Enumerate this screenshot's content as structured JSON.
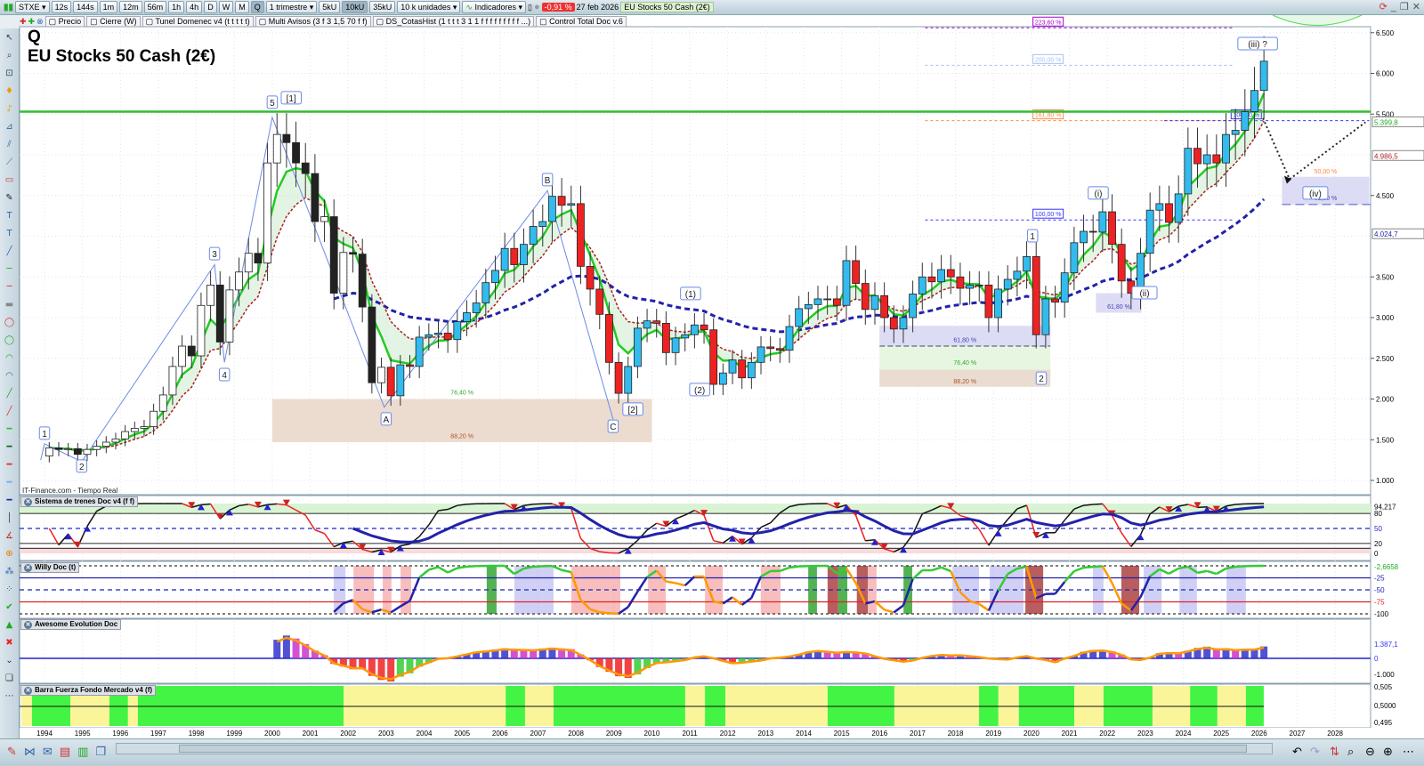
{
  "toolbar": {
    "symbol": "STXE",
    "timeframes": [
      "12s",
      "144s",
      "1m",
      "12m",
      "56m",
      "1h",
      "4h",
      "D",
      "W",
      "M",
      "Q"
    ],
    "active_timeframe": "Q",
    "period": "1 trimestre",
    "units": [
      "5kU",
      "10kU",
      "35kU"
    ],
    "active_unit": "10kU",
    "units_select": "10 k unidades",
    "indicators": "Indicadores",
    "change": "-0,91 %",
    "date": "27 feb 2026",
    "instrument": "EU Stocks 50 Cash (2€)"
  },
  "overlays": [
    "Precio",
    "Cierre (W)",
    "Tunel Domenec v4 (t t t t t)",
    "Multi Avisos (3 f 3 1,5 70 f f)",
    "DS_CotasHist (1 t t t 3 1 1 f f f f f f f f f ...)",
    "Control Total Doc v.6"
  ],
  "chart": {
    "period_letter": "Q",
    "title": "EU Stocks 50 Cash (2€)",
    "source": "IT-Finance.com - Tiempo Real"
  },
  "panels": {
    "trenes": "Sistema de trenes Doc v4 (f f)",
    "willy": "Willy Doc (t)",
    "awesome": "Awesome Evolution Doc",
    "barra": "Barra Fuerza Fondo Mercado v4 (f)"
  },
  "axis_labels": {
    "price": [
      "6.500",
      "6.000",
      "5.500",
      "4.500",
      "3.500",
      "3.000",
      "2.500",
      "2.000",
      "1.500",
      "1.000"
    ],
    "tags": {
      "green": "5.399,8",
      "red": "4.986,5",
      "blue": "4.024,7"
    },
    "trenes": [
      "94,217",
      "80",
      "50",
      "20",
      "0"
    ],
    "willy": [
      "-2,6658",
      "-25",
      "-50",
      "-75",
      "-100"
    ],
    "awesome": [
      "1.387,1",
      "0",
      "-1.000"
    ],
    "barra": [
      "0,505",
      "0,5000",
      "0,495"
    ]
  },
  "chart_data": {
    "type": "candlestick",
    "start_year": 1994,
    "period": "quarter",
    "closes": [
      1400,
      1380,
      1390,
      1320,
      1380,
      1420,
      1470,
      1510,
      1600,
      1640,
      1660,
      1850,
      2050,
      2400,
      2650,
      2530,
      3150,
      3400,
      2700,
      3340,
      3560,
      3790,
      3670,
      4900,
      5250,
      5150,
      4900,
      4770,
      4180,
      4240,
      3300,
      3800,
      3780,
      3130,
      2200,
      2390,
      2040,
      2420,
      2400,
      2760,
      2790,
      2810,
      2730,
      2950,
      3060,
      3180,
      3430,
      3580,
      3850,
      3650,
      3900,
      4120,
      4180,
      4490,
      4380,
      4400,
      3630,
      3350,
      3040,
      2450,
      2070,
      2400,
      2870,
      2960,
      2930,
      2570,
      2750,
      2790,
      2910,
      2850,
      2180,
      2320,
      2480,
      2260,
      2450,
      2640,
      2620,
      2600,
      2890,
      3110,
      3160,
      3230,
      3230,
      3150,
      3700,
      3420,
      3100,
      3270,
      3000,
      2860,
      3000,
      3290,
      3500,
      3440,
      3590,
      3500,
      3360,
      3400,
      3400,
      3000,
      3350,
      3470,
      3570,
      3750,
      2790,
      3230,
      3190,
      3550,
      3920,
      4060,
      4050,
      4300,
      3900,
      3450,
      3300,
      3790,
      4320,
      4400,
      4170,
      4520,
      5080,
      4890,
      5000,
      4900,
      5250,
      5300,
      5530,
      5790,
      6150
    ],
    "first_open": 1300,
    "ylim": [
      1000,
      6500
    ],
    "xlim": [
      1993.4,
      2028.9
    ],
    "years": [
      1994,
      1995,
      1996,
      1997,
      1998,
      1999,
      2000,
      2001,
      2002,
      2003,
      2004,
      2005,
      2006,
      2007,
      2008,
      2009,
      2010,
      2011,
      2012,
      2013,
      2014,
      2015,
      2016,
      2017,
      2018,
      2019,
      2020,
      2021,
      2022,
      2023,
      2024,
      2025,
      2026,
      2027,
      2028
    ],
    "resistance": 5530,
    "waves": [
      {
        "t": "1",
        "x": 1994.0,
        "y": 1570
      },
      {
        "t": "2",
        "x": 1994.98,
        "y": 1165
      },
      {
        "t": "3",
        "x": 1998.48,
        "y": 3775
      },
      {
        "t": "4",
        "x": 1998.74,
        "y": 2290
      },
      {
        "t": "5",
        "x": 2000.0,
        "y": 5635
      },
      {
        "t": "[1]",
        "x": 2000.5,
        "y": 5690
      },
      {
        "t": "A",
        "x": 2003.0,
        "y": 1745
      },
      {
        "t": "B",
        "x": 2007.25,
        "y": 4685
      },
      {
        "t": "C",
        "x": 2008.98,
        "y": 1655
      },
      {
        "t": "[2]",
        "x": 2009.5,
        "y": 1865
      },
      {
        "t": "(1)",
        "x": 2011.02,
        "y": 3285
      },
      {
        "t": "(2)",
        "x": 2011.26,
        "y": 2105
      },
      {
        "t": "1",
        "x": 2020.03,
        "y": 3995
      },
      {
        "t": "2",
        "x": 2020.26,
        "y": 2245
      },
      {
        "t": "(i)",
        "x": 2021.76,
        "y": 4520
      },
      {
        "t": "(ii)",
        "x": 2022.98,
        "y": 3295
      },
      {
        "t": "(iii) ?",
        "x": 2025.96,
        "y": 6355
      },
      {
        "t": "(iv)",
        "x": 2027.48,
        "y": 4520
      }
    ],
    "wave_path": [
      [
        1993.9,
        1250
      ],
      [
        1994.0,
        1450
      ],
      [
        1994.98,
        1230
      ],
      [
        1998.48,
        3650
      ],
      [
        1998.74,
        2450
      ],
      [
        2000.0,
        5460
      ],
      [
        2002.95,
        1900
      ],
      [
        2007.25,
        4560
      ],
      [
        2008.98,
        1750
      ]
    ],
    "fib_zones": [
      {
        "x": [
          2000.0,
          2010.0
        ],
        "y": [
          2000,
          1470
        ],
        "color": "#ecdcd0",
        "labels": [
          {
            "t": "76,40 %",
            "y": 2055,
            "c": "#3a3"
          },
          {
            "t": "88,20 %",
            "y": 1520,
            "c": "#a52"
          }
        ]
      },
      {
        "x": [
          2016.0,
          2020.5
        ],
        "y": [
          2900,
          2650
        ],
        "color": "#dcdcf4",
        "labels": [
          {
            "t": "61,80 %",
            "y": 2700,
            "c": "#44b"
          }
        ]
      },
      {
        "x": [
          2016.0,
          2020.5
        ],
        "y": [
          2650,
          2360
        ],
        "color": "#e6f6e0",
        "labels": [
          {
            "t": "76,40 %",
            "y": 2420,
            "c": "#3a3"
          }
        ]
      },
      {
        "x": [
          2016.0,
          2020.5
        ],
        "y": [
          2360,
          2150
        ],
        "color": "#eadcd0",
        "labels": [
          {
            "t": "88,20 %",
            "y": 2190,
            "c": "#a52"
          }
        ]
      },
      {
        "x": [
          2021.7,
          2022.9
        ],
        "y": [
          3300,
          3060
        ],
        "color": "#dcdcf4",
        "labels": [
          {
            "t": "61,80 %",
            "y": 3110,
            "c": "#44b"
          }
        ]
      },
      {
        "x": [
          2026.6,
          2028.9
        ],
        "y": [
          4730,
          4390
        ],
        "color": "#dcdcf4",
        "labels": [
          {
            "t": "50,00 %",
            "y": 4770,
            "c": "#f84"
          },
          {
            "t": "61,80 %",
            "y": 4440,
            "c": "#44b"
          }
        ]
      }
    ],
    "fib_lines": [
      {
        "t": "223,60 %",
        "y": 6560,
        "c": "#a0c",
        "x": [
          2017.2,
          2025.3
        ]
      },
      {
        "t": "200,00 %",
        "y": 6100,
        "c": "#aac0f0",
        "x": [
          2017.2,
          2025.3
        ]
      },
      {
        "t": "161,80 %",
        "y": 5420,
        "c": "#f84",
        "x": [
          2017.2,
          2025.3
        ]
      },
      {
        "t": "100,00 %",
        "y": 5420,
        "c": "#33f",
        "x": [
          2023.5,
          2028.9
        ]
      },
      {
        "t": "100,00 %",
        "y": 4200,
        "c": "#33f",
        "x": [
          2017.2,
          2025.3
        ]
      }
    ],
    "projection": [
      [
        2026.1,
        5450
      ],
      [
        2026.8,
        4700
      ],
      [
        2028.8,
        5400
      ]
    ],
    "barra_segments": [
      [
        1993.39,
        1993.67,
        "y"
      ],
      [
        1993.67,
        1994.68,
        "g"
      ],
      [
        1994.68,
        1995.71,
        "y"
      ],
      [
        1995.71,
        1996.2,
        "g"
      ],
      [
        1996.2,
        1996.46,
        "y"
      ],
      [
        1996.46,
        2001.88,
        "g"
      ],
      [
        2001.88,
        2006.15,
        "y"
      ],
      [
        2006.15,
        2006.66,
        "g"
      ],
      [
        2006.66,
        2007.41,
        "y"
      ],
      [
        2007.41,
        2010.88,
        "g"
      ],
      [
        2010.88,
        2011.4,
        "y"
      ],
      [
        2011.4,
        2011.94,
        "g"
      ],
      [
        2011.94,
        2014.63,
        "y"
      ],
      [
        2014.63,
        2016.39,
        "g"
      ],
      [
        2016.39,
        2018.62,
        "y"
      ],
      [
        2018.62,
        2019.13,
        "g"
      ],
      [
        2019.13,
        2019.67,
        "y"
      ],
      [
        2019.67,
        2021.13,
        "g"
      ],
      [
        2021.13,
        2021.9,
        "y"
      ],
      [
        2021.9,
        2023.19,
        "g"
      ],
      [
        2023.19,
        2024.18,
        "y"
      ],
      [
        2024.18,
        2024.9,
        "g"
      ],
      [
        2024.9,
        2025.65,
        "y"
      ],
      [
        2025.65,
        2026.12,
        "g"
      ]
    ],
    "willy_bands": [
      [
        2001.62,
        2001.93,
        "b"
      ],
      [
        2002.14,
        2002.68,
        "r"
      ],
      [
        2002.91,
        2003.14,
        "r"
      ],
      [
        2003.38,
        2003.66,
        "r"
      ],
      [
        2005.65,
        2005.91,
        "g"
      ],
      [
        2006.38,
        2007.41,
        "b"
      ],
      [
        2007.88,
        2009.17,
        "r"
      ],
      [
        2009.9,
        2010.37,
        "r"
      ],
      [
        2011.4,
        2011.87,
        "r"
      ],
      [
        2012.87,
        2013.39,
        "r"
      ],
      [
        2014.12,
        2014.35,
        "g"
      ],
      [
        2014.63,
        2014.91,
        "d"
      ],
      [
        2014.91,
        2015.15,
        "g"
      ],
      [
        2015.4,
        2015.69,
        "d"
      ],
      [
        2015.69,
        2015.92,
        "r"
      ],
      [
        2016.63,
        2016.86,
        "g"
      ],
      [
        2017.92,
        2018.62,
        "b"
      ],
      [
        2018.9,
        2019.79,
        "b"
      ],
      [
        2019.84,
        2020.31,
        "d"
      ],
      [
        2021.62,
        2021.9,
        "b"
      ],
      [
        2022.37,
        2022.84,
        "d"
      ],
      [
        2022.96,
        2023.43,
        "b"
      ],
      [
        2023.9,
        2024.36,
        "b"
      ],
      [
        2025.14,
        2025.65,
        "b"
      ]
    ]
  }
}
